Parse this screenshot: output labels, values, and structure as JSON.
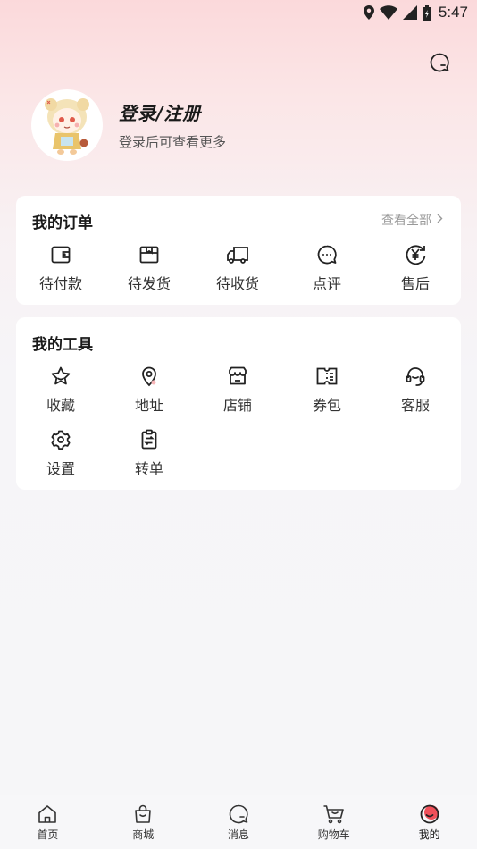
{
  "status_bar": {
    "time": "5:47",
    "icons": [
      "location-icon",
      "wifi-icon",
      "signal-icon",
      "battery-icon"
    ]
  },
  "header": {
    "message_icon": "chat-bubble-icon"
  },
  "profile": {
    "title": "登录/注册",
    "subtitle": "登录后可查看更多",
    "avatar": "cartoon-avatar"
  },
  "orders": {
    "title": "我的订单",
    "view_all": "查看全部",
    "items": [
      {
        "label": "待付款",
        "icon": "wallet-icon"
      },
      {
        "label": "待发货",
        "icon": "box-icon"
      },
      {
        "label": "待收货",
        "icon": "truck-icon"
      },
      {
        "label": "点评",
        "icon": "comment-icon"
      },
      {
        "label": "售后",
        "icon": "yen-refund-icon"
      }
    ]
  },
  "tools": {
    "title": "我的工具",
    "items": [
      {
        "label": "收藏",
        "icon": "star-icon"
      },
      {
        "label": "地址",
        "icon": "location-pin-icon"
      },
      {
        "label": "店铺",
        "icon": "store-icon"
      },
      {
        "label": "券包",
        "icon": "coupon-icon"
      },
      {
        "label": "客服",
        "icon": "headset-icon"
      },
      {
        "label": "设置",
        "icon": "gear-icon"
      },
      {
        "label": "转单",
        "icon": "transfer-order-icon"
      }
    ]
  },
  "tabbar": {
    "items": [
      {
        "label": "首页",
        "icon": "home-icon"
      },
      {
        "label": "商城",
        "icon": "shopping-bag-icon"
      },
      {
        "label": "消息",
        "icon": "message-icon"
      },
      {
        "label": "购物车",
        "icon": "cart-icon"
      },
      {
        "label": "我的",
        "icon": "profile-icon",
        "active": true
      }
    ]
  },
  "colors": {
    "accent": "#f0505a",
    "background_top": "#fbd9db",
    "card": "#ffffff"
  }
}
